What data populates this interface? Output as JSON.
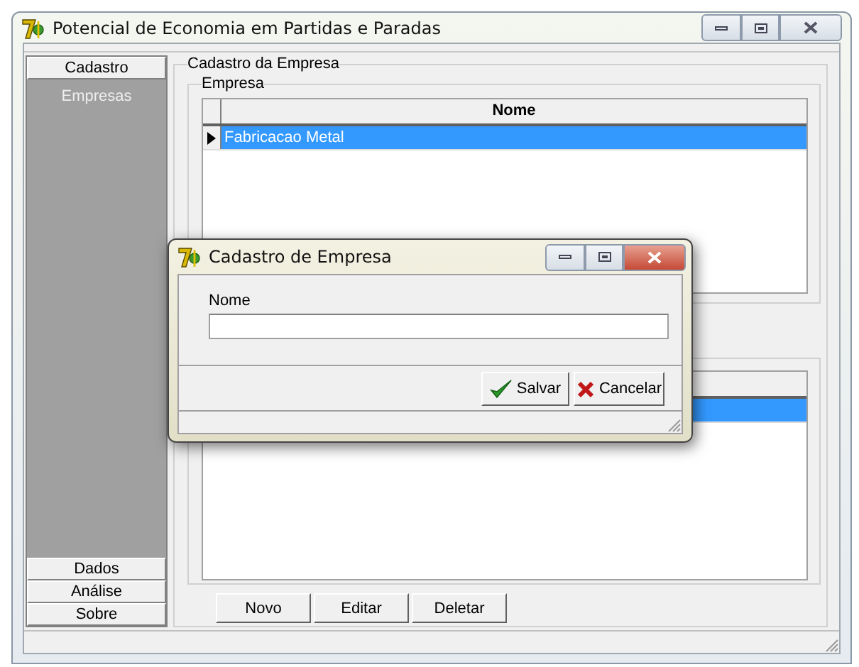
{
  "window": {
    "title": "Potencial de Economia em Partidas e Paradas"
  },
  "sidebar": {
    "sections": [
      {
        "label": "Cadastro",
        "items": [
          {
            "label": "Empresas"
          }
        ]
      },
      {
        "label": "Dados"
      },
      {
        "label": "Análise"
      },
      {
        "label": "Sobre"
      }
    ]
  },
  "main": {
    "group_title": "Cadastro da Empresa",
    "company_group": {
      "title": "Empresa",
      "table": {
        "columns": [
          "Nome"
        ],
        "rows": [
          {
            "cells": [
              "Fabricacao Metal"
            ],
            "selected": true
          }
        ]
      }
    },
    "lower_table": {
      "rows": [
        {
          "selected": true
        }
      ]
    },
    "buttons": [
      "Novo",
      "Editar",
      "Deletar"
    ]
  },
  "dialog": {
    "title": "Cadastro de Empresa",
    "field": {
      "label": "Nome"
    },
    "buttons": [
      {
        "label": "Salvar",
        "kind": "save"
      },
      {
        "label": "Cancelar",
        "kind": "cancel"
      }
    ]
  }
}
